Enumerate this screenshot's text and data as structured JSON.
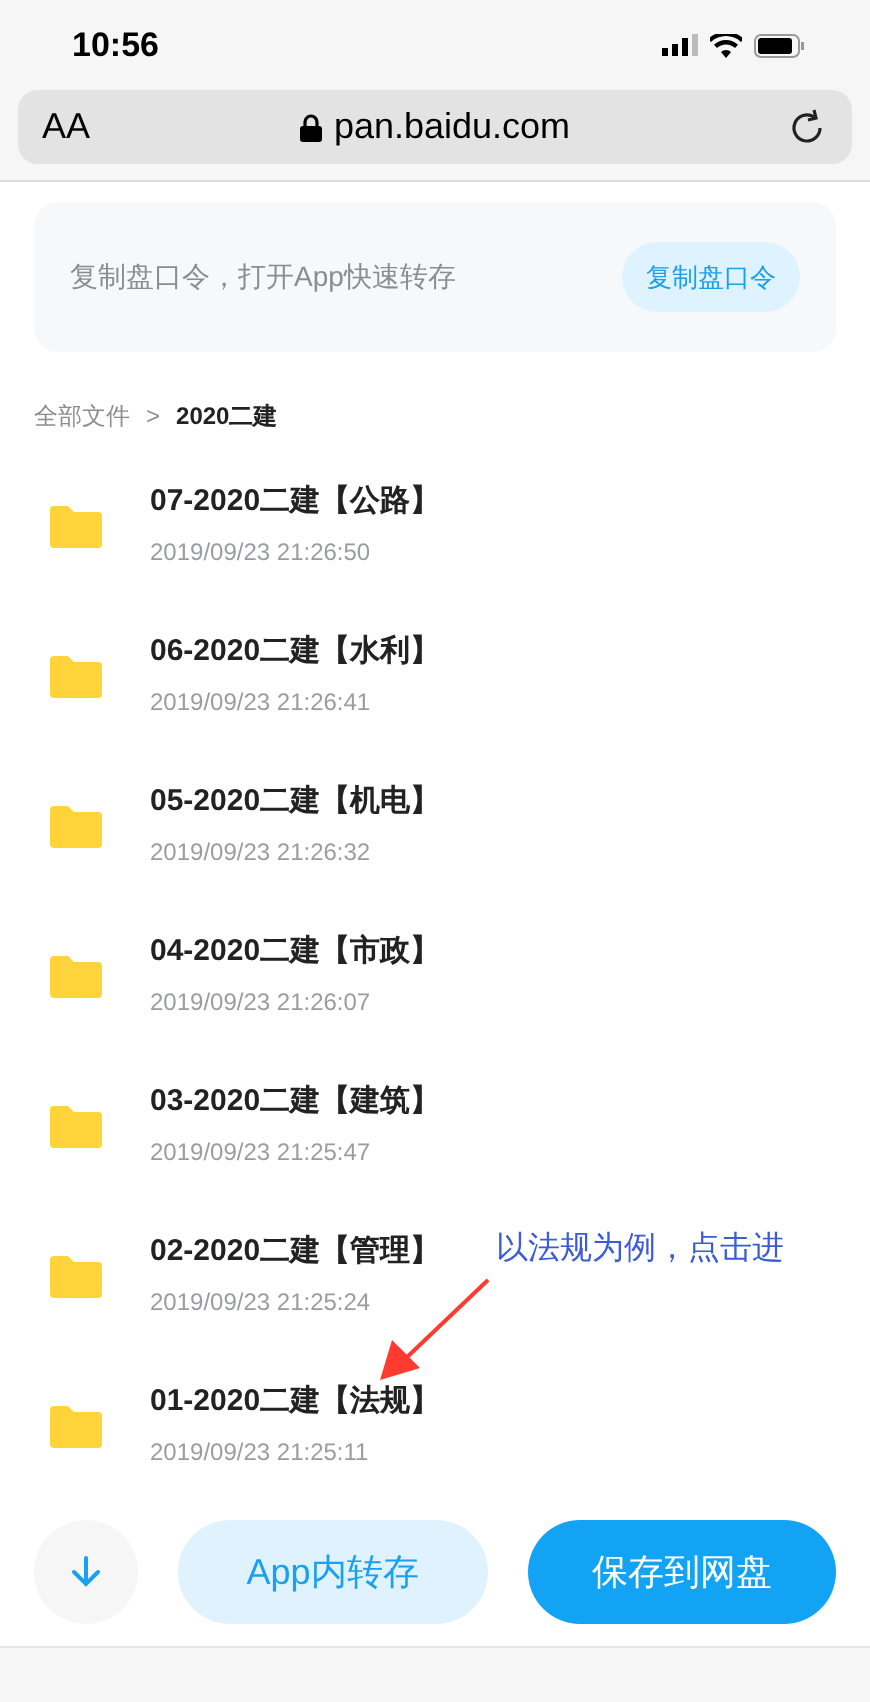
{
  "status_bar": {
    "time": "10:56"
  },
  "address_bar": {
    "text_size": "AA",
    "url": "pan.baidu.com"
  },
  "banner": {
    "text": "复制盘口令，打开App快速转存",
    "button": "复制盘口令"
  },
  "breadcrumb": {
    "root": "全部文件",
    "separator": ">",
    "current": "2020二建"
  },
  "files": [
    {
      "name": "07-2020二建【公路】",
      "date": "2019/09/23 21:26:50"
    },
    {
      "name": "06-2020二建【水利】",
      "date": "2019/09/23 21:26:41"
    },
    {
      "name": "05-2020二建【机电】",
      "date": "2019/09/23 21:26:32"
    },
    {
      "name": "04-2020二建【市政】",
      "date": "2019/09/23 21:26:07"
    },
    {
      "name": "03-2020二建【建筑】",
      "date": "2019/09/23 21:25:47"
    },
    {
      "name": "02-2020二建【管理】",
      "date": "2019/09/23 21:25:24"
    },
    {
      "name": "01-2020二建【法规】",
      "date": "2019/09/23 21:25:11"
    }
  ],
  "annotation": {
    "text": "以法规为例，点击进"
  },
  "actions": {
    "app_save": "App内转存",
    "save": "保存到网盘"
  }
}
